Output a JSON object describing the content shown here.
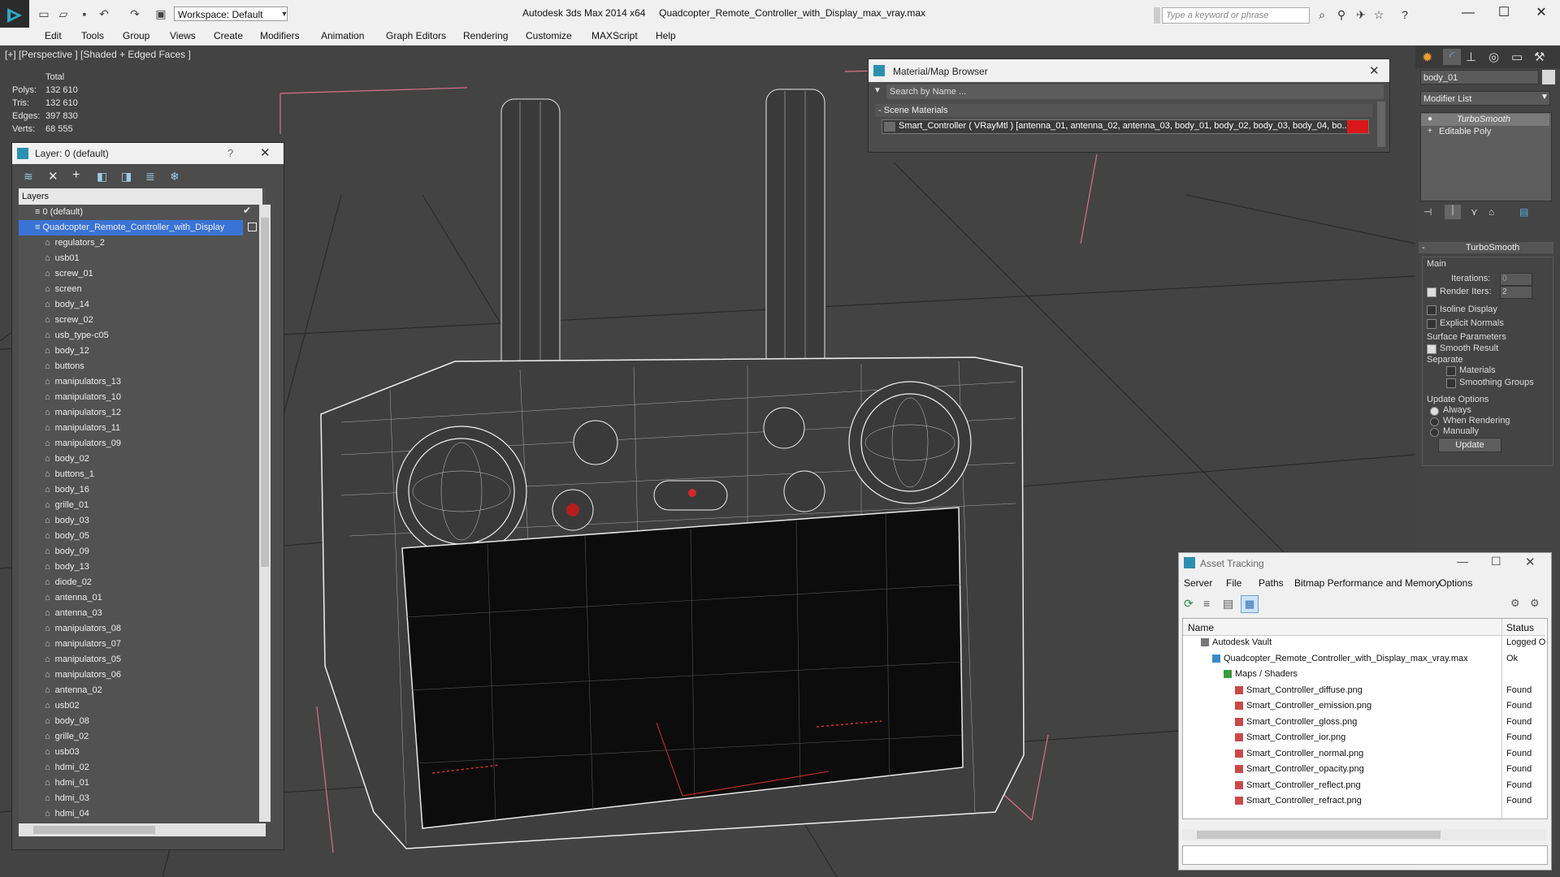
{
  "app_title": "Autodesk 3ds Max  2014 x64",
  "file_title": "Quadcopter_Remote_Controller_with_Display_max_vray.max",
  "workspace": "Workspace: Default",
  "search_placeholder": "Type a keyword or phrase",
  "menu": [
    "Edit",
    "Tools",
    "Group",
    "Views",
    "Create",
    "Modifiers",
    "Animation",
    "Graph Editors",
    "Rendering",
    "Customize",
    "MAXScript",
    "Help"
  ],
  "viewport": {
    "label": "[+] [Perspective ] [Shaded + Edged Faces ]",
    "stats": {
      "total": "Total",
      "polys_label": "Polys:",
      "polys": "132 610",
      "tris_label": "Tris:",
      "tris": "132 610",
      "edges_label": "Edges:",
      "edges": "397 830",
      "verts_label": "Verts:",
      "verts": "68 555"
    }
  },
  "layer_panel": {
    "title": "Layer: 0 (default)",
    "help": "?",
    "header": "Layers",
    "default_layer": "0 (default)",
    "selected_layer": "Quadcopter_Remote_Controller_with_Display",
    "items": [
      "regulators_2",
      "usb01",
      "screw_01",
      "screen",
      "body_14",
      "screw_02",
      "usb_type-c05",
      "body_12",
      "buttons",
      "manipulators_13",
      "manipulators_10",
      "manipulators_12",
      "manipulators_11",
      "manipulators_09",
      "body_02",
      "buttons_1",
      "body_16",
      "grille_01",
      "body_03",
      "body_05",
      "body_09",
      "body_13",
      "diode_02",
      "antenna_01",
      "antenna_03",
      "manipulators_08",
      "manipulators_07",
      "manipulators_05",
      "manipulators_06",
      "antenna_02",
      "usb02",
      "body_08",
      "grille_02",
      "usb03",
      "hdmi_02",
      "hdmi_01",
      "hdmi_03",
      "hdmi_04"
    ]
  },
  "material_browser": {
    "title": "Material/Map Browser",
    "search_placeholder": "Search by Name ...",
    "group": "Scene Materials",
    "material": "Smart_Controller  ( VRayMtl )  [antenna_01, antenna_02, antenna_03, body_01, body_02, body_03, body_04, bo..."
  },
  "modify_panel": {
    "object_name": "body_01",
    "modifier_list": "Modifier List",
    "stack": [
      "TurboSmooth",
      "Editable Poly"
    ],
    "rollout": "TurboSmooth",
    "main": "Main",
    "iterations_label": "Iterations:",
    "iterations": "0",
    "render_iters_label": "Render Iters:",
    "render_iters": "2",
    "isoline": "Isoline Display",
    "explicit_normals": "Explicit Normals",
    "surface_params": "Surface Parameters",
    "smooth_result": "Smooth Result",
    "separate": "Separate",
    "materials": "Materials",
    "smoothing_groups": "Smoothing Groups",
    "update_options": "Update Options",
    "always": "Always",
    "when_rendering": "When Rendering",
    "manually": "Manually",
    "update_button": "Update"
  },
  "asset_tracking": {
    "title": "Asset Tracking",
    "menu": [
      "Server",
      "File",
      "Paths",
      "Bitmap Performance and Memory",
      "Options"
    ],
    "col_name": "Name",
    "col_status": "Status",
    "rows": [
      {
        "name": "Autodesk Vault",
        "status": "Logged O",
        "indent": 0
      },
      {
        "name": "Quadcopter_Remote_Controller_with_Display_max_vray.max",
        "status": "Ok",
        "indent": 1
      },
      {
        "name": "Maps / Shaders",
        "status": "",
        "indent": 2
      },
      {
        "name": "Smart_Controller_diffuse.png",
        "status": "Found",
        "indent": 3
      },
      {
        "name": "Smart_Controller_emission.png",
        "status": "Found",
        "indent": 3
      },
      {
        "name": "Smart_Controller_gloss.png",
        "status": "Found",
        "indent": 3
      },
      {
        "name": "Smart_Controller_ior.png",
        "status": "Found",
        "indent": 3
      },
      {
        "name": "Smart_Controller_normal.png",
        "status": "Found",
        "indent": 3
      },
      {
        "name": "Smart_Controller_opacity.png",
        "status": "Found",
        "indent": 3
      },
      {
        "name": "Smart_Controller_reflect.png",
        "status": "Found",
        "indent": 3
      },
      {
        "name": "Smart_Controller_refract.png",
        "status": "Found",
        "indent": 3
      }
    ]
  },
  "colors": {
    "selection": "#3a73d6",
    "title_bg": "#f0f0f0",
    "viewport_bg": "#434343",
    "highlight_red": "#d81818"
  }
}
